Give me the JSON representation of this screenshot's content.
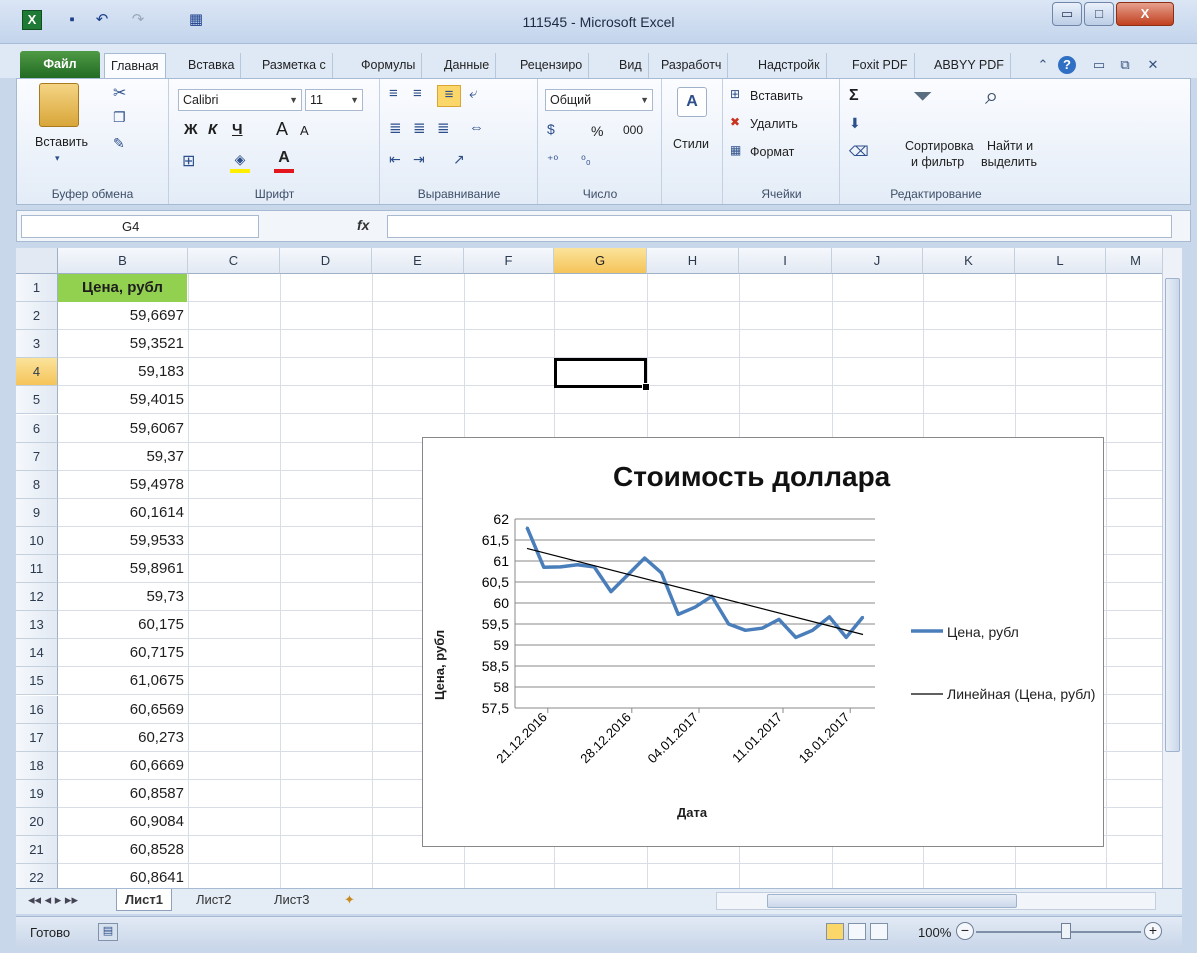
{
  "window": {
    "title": "111545  -  Microsoft Excel",
    "app_icon": "X",
    "minimize": "▭",
    "maximize": "□",
    "close": "X"
  },
  "ribbon_tabs": [
    "Файл",
    "Главная",
    "Вставка",
    "Разметка с",
    "Формулы",
    "Данные",
    "Рецензиро",
    "Вид",
    "Разработч",
    "Надстройк",
    "Foxit PDF",
    "ABBYY PDF"
  ],
  "clipboard": {
    "paste": "Вставить",
    "group": "Буфер обмена"
  },
  "font": {
    "name": "Calibri",
    "size": "11",
    "bold": "Ж",
    "italic": "К",
    "underline": "Ч",
    "grow": "A",
    "shrink": "A",
    "group": "Шрифт"
  },
  "alignment": {
    "group": "Выравнивание"
  },
  "number": {
    "format": "Общий",
    "percent": "%",
    "thousands": "000",
    "inc_decimal": "←,0 ,00",
    "dec_decimal": ",00 →,0",
    "group": "Число"
  },
  "styles": {
    "label": "Стили"
  },
  "cells": {
    "insert": "Вставить",
    "delete": "Удалить",
    "format": "Формат",
    "group": "Ячейки"
  },
  "editing": {
    "sum": "Σ",
    "sort": "Сортировка",
    "sort2": "и фильтр",
    "find": "Найти и",
    "find2": "выделить",
    "group": "Редактирование"
  },
  "formula_bar": {
    "name_box": "G4",
    "fx": "fx",
    "value": ""
  },
  "sheet": {
    "columns": [
      "B",
      "C",
      "D",
      "E",
      "F",
      "G",
      "H",
      "I",
      "J",
      "K",
      "L",
      "M"
    ],
    "selected_column": "G",
    "rows": [
      "1",
      "2",
      "3",
      "4",
      "5",
      "6",
      "7",
      "8",
      "9",
      "10",
      "11",
      "12",
      "13",
      "14",
      "15",
      "16",
      "17",
      "18",
      "19",
      "20",
      "21",
      "22"
    ],
    "selected_row": "4",
    "header": "Цена, рубл",
    "values": [
      "59,6697",
      "59,3521",
      "59,183",
      "59,4015",
      "59,6067",
      "59,37",
      "59,4978",
      "60,1614",
      "59,9533",
      "59,8961",
      "59,73",
      "60,175",
      "60,7175",
      "61,0675",
      "60,6569",
      "60,273",
      "60,6669",
      "60,8587",
      "60,9084",
      "60,8528",
      "60,8641"
    ]
  },
  "chart_data": {
    "type": "line",
    "title": "Стоимость доллара",
    "xlabel": "Дата",
    "ylabel": "Цена, рубл",
    "ylim": [
      57.5,
      62
    ],
    "y_ticks": [
      "62",
      "61,5",
      "61",
      "60,5",
      "60",
      "59,5",
      "59",
      "58,5",
      "58",
      "57,5"
    ],
    "x_ticks": [
      "21.12.2016",
      "28.12.2016",
      "04.01.2017",
      "11.01.2017",
      "18.01.2017"
    ],
    "grid": true,
    "legend_position": "right",
    "series": [
      {
        "name": "Цена, рубл",
        "color": "#4a7ebb",
        "x": [
          "20.12.2016",
          "21.12.2016",
          "22.12.2016",
          "23.12.2016",
          "24.12.2016",
          "27.12.2016",
          "28.12.2016",
          "29.12.2016",
          "30.12.2016",
          "31.12.2016",
          "10.01.2017",
          "11.01.2017",
          "12.01.2017",
          "13.01.2017",
          "14.01.2017",
          "17.01.2017",
          "18.01.2017",
          "19.01.2017",
          "20.01.2017",
          "21.01.2017",
          "24.01.2017"
        ],
        "values": [
          61.8,
          60.85,
          60.86,
          60.91,
          60.86,
          60.27,
          60.67,
          61.07,
          60.72,
          59.73,
          59.9,
          60.16,
          59.5,
          59.35,
          59.4,
          59.61,
          59.18,
          59.35,
          59.67,
          59.18,
          59.67
        ]
      }
    ],
    "trendline": {
      "name": "Линейная (Цена, рубл)",
      "color": "#000000",
      "start": 61.3,
      "end": 59.25
    }
  },
  "sheet_tabs": [
    "Лист1",
    "Лист2",
    "Лист3"
  ],
  "status": {
    "ready": "Готово",
    "zoom": "100%",
    "minus": "−",
    "plus": "+"
  }
}
